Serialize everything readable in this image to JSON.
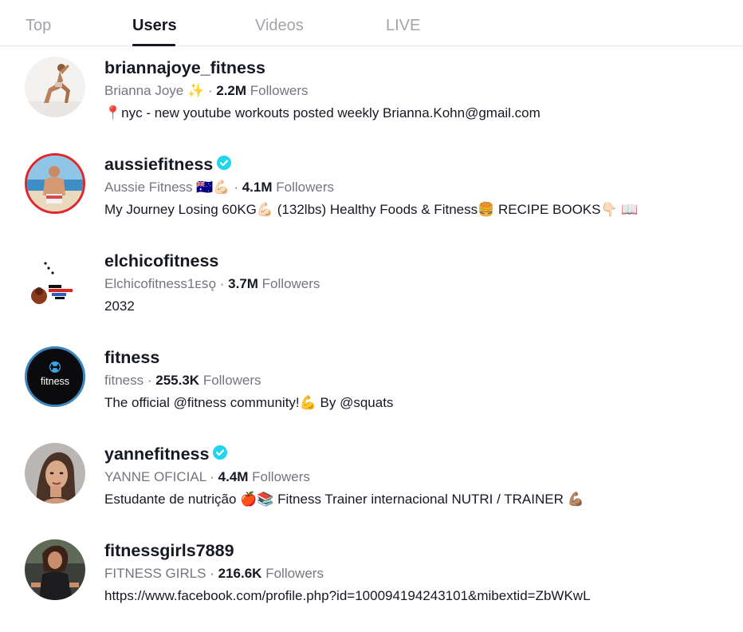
{
  "tabs": [
    {
      "label": "Top",
      "active": false
    },
    {
      "label": "Users",
      "active": true
    },
    {
      "label": "Videos",
      "active": false
    },
    {
      "label": "LIVE",
      "active": false
    }
  ],
  "users": [
    {
      "username": "briannajoye_fitness",
      "verified": false,
      "nickname": "Brianna Joye ✨",
      "followers": "2.2M",
      "followers_label": "Followers",
      "bio": "📍nyc - new youtube workouts posted weekly Brianna.Kohn@gmail.com",
      "avatar_icon": "woman-stretching-photo"
    },
    {
      "username": "aussiefitness",
      "verified": true,
      "nickname": "Aussie Fitness 🇦🇺💪🏻",
      "followers": "4.1M",
      "followers_label": "Followers",
      "bio": "My Journey Losing 60KG💪🏻 (132lbs) Healthy Foods & Fitness🍔 RECIPE BOOKS👇🏻 📖",
      "avatar_icon": "man-on-beach-photo",
      "avatar_ring": "live"
    },
    {
      "username": "elchicofitness",
      "verified": false,
      "nickname": "Elchicofitness1ᴇꜱǫ",
      "followers": "3.7M",
      "followers_label": "Followers",
      "bio": "2032",
      "avatar_icon": "make-elchicofitness-logo"
    },
    {
      "username": "fitness",
      "verified": false,
      "nickname": "fitness",
      "followers": "255.3K",
      "followers_label": "Followers",
      "bio": "The official @fitness community!💪 By @squats",
      "avatar_icon": "fitness-logo",
      "avatar_logo_text": "fitness",
      "avatar_ring": "blue"
    },
    {
      "username": "yannefitness",
      "verified": true,
      "nickname": "YANNE OFICIAL",
      "followers": "4.4M",
      "followers_label": "Followers",
      "bio": "Estudante de nutrição 🍎📚 Fitness Trainer internacional NUTRI / TRAINER 💪🏽",
      "avatar_icon": "woman-portrait-photo"
    },
    {
      "username": "fitnessgirls7889",
      "verified": false,
      "nickname": "FITNESS GIRLS",
      "followers": "216.6K",
      "followers_label": "Followers",
      "bio": "https://www.facebook.com/profile.php?id=100094194243101&mibextid=ZbWKwL",
      "avatar_icon": "woman-gym-photo"
    }
  ],
  "separator": " · ",
  "colors": {
    "text_primary": "#161823",
    "text_secondary": "#75767d",
    "tab_inactive": "#a3a4aa",
    "verified": "#20d5ec",
    "live_ring": "#e0262c"
  }
}
